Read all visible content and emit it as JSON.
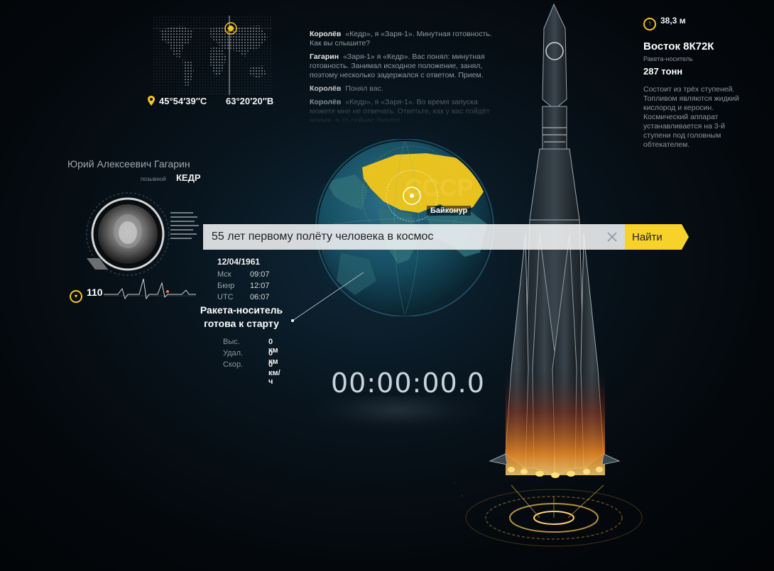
{
  "location": {
    "lat": "45°54′39″С",
    "lon": "63°20′20″В"
  },
  "dialogue": [
    {
      "speaker": "Королёв",
      "text": "«Кедр», я «Заря-1». Минутная готовность. Как вы слышите?"
    },
    {
      "speaker": "Гагарин",
      "text": "«Заря-1» я «Кедр». Вас понял: минутная готовность. Занимал исходное положение, занял, поэтому несколько задержался с ответом. Прием."
    },
    {
      "speaker": "Королёв",
      "text": "Понял вас."
    },
    {
      "speaker": "Королёв",
      "text": "«Кедр», я «Заря-1». Во время запуска можете мне не отвечать. Ответьте, как у вас пойдёт время, а то сейчас будете"
    }
  ],
  "person": {
    "name": "Юрий Алексеевич Гагарин",
    "callsign_label": "позывной",
    "callsign": "КЕДР",
    "pulse": "110"
  },
  "times": {
    "date": "12/04/1961",
    "rows": [
      {
        "label": "Мск",
        "value": "09:07"
      },
      {
        "label": "Бкнр",
        "value": "12:07"
      },
      {
        "label": "UTC",
        "value": "06:07"
      }
    ]
  },
  "status": {
    "line1": "Ракета-носитель",
    "line2": "готова к старту"
  },
  "measures": [
    {
      "label": "Выс.",
      "value": "0 км"
    },
    {
      "label": "Удал.",
      "value": "0 км"
    },
    {
      "label": "Скор.",
      "value": "0 км/ч"
    }
  ],
  "timer": "00:00:00.0",
  "search": {
    "value": "55 лет первому полёту человека в космос",
    "button": "Найти"
  },
  "globe": {
    "country": "СССР",
    "site": "Байконур"
  },
  "rocket": {
    "height": "38,3 м",
    "name": "Восток 8К72К",
    "type": "Ракета-носитель",
    "mass": "287 тонн",
    "description": "Состоит из трёх ступеней. Топливом являются жидкий кислород и керосин. Космический аппарат устанавливается на 3-й ступени под головным обтекателем."
  },
  "colors": {
    "accent": "#f5c518",
    "button": "#f7d22b"
  },
  "icons": [
    "location-pin-icon",
    "heart-icon",
    "arrow-up-icon",
    "clear-icon",
    "globe-icon",
    "rocket-icon",
    "ecg-icon",
    "world-map-icon"
  ]
}
